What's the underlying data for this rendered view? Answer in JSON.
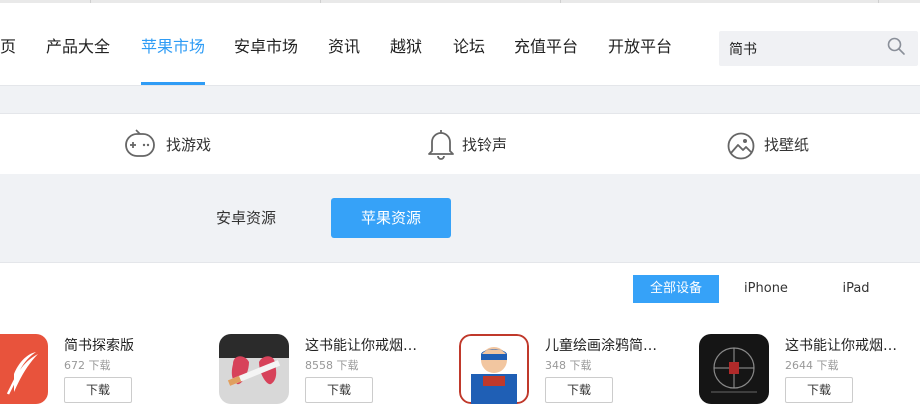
{
  "nav": {
    "items": [
      {
        "label": "页",
        "active": false
      },
      {
        "label": "产品大全",
        "active": false
      },
      {
        "label": "苹果市场",
        "active": true
      },
      {
        "label": "安卓市场",
        "active": false
      },
      {
        "label": "资讯",
        "active": false
      },
      {
        "label": "越狱",
        "active": false
      },
      {
        "label": "论坛",
        "active": false
      },
      {
        "label": "充值平台",
        "active": false
      },
      {
        "label": "开放平台",
        "active": false
      }
    ],
    "search": {
      "value": "简书",
      "icon": "search-icon"
    }
  },
  "categories": [
    {
      "label": "找游戏",
      "icon": "gamepad-icon"
    },
    {
      "label": "找铃声",
      "icon": "bell-icon"
    },
    {
      "label": "找壁纸",
      "icon": "wallpaper-icon"
    }
  ],
  "source_tabs": {
    "android": "安卓资源",
    "apple": "苹果资源",
    "selected": "apple"
  },
  "device_tabs": {
    "all": "全部设备",
    "iphone": "iPhone",
    "ipad": "iPad",
    "selected": "all"
  },
  "apps": [
    {
      "name": "简书探索版",
      "downloads": "672 下载",
      "button": "下载",
      "icon": "feather-logo-icon"
    },
    {
      "name": "这书能让你戒烟…",
      "downloads": "8558 下载",
      "button": "下载",
      "icon": "quit-smoking-icon"
    },
    {
      "name": "儿童绘画涂鸦简…",
      "downloads": "348 下载",
      "button": "下载",
      "icon": "superhero-icon"
    },
    {
      "name": "这书能让你戒烟…",
      "downloads": "2644 下载",
      "button": "下载",
      "icon": "dark-book-icon"
    }
  ],
  "colors": {
    "accent": "#2f9cf5",
    "button_blue": "#36a2f8",
    "band_bg": "#f0f2f5"
  }
}
